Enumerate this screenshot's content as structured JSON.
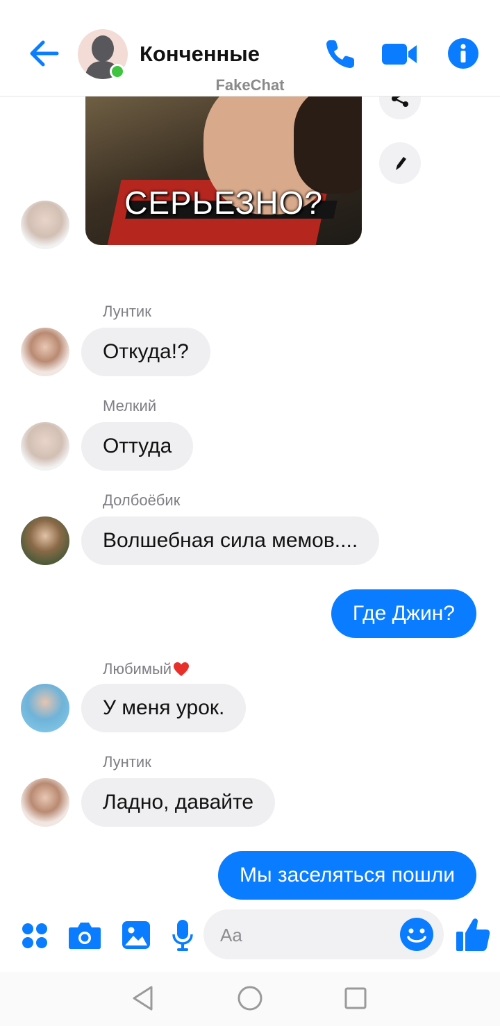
{
  "header": {
    "title": "Конченные",
    "watermark": "FakeChat"
  },
  "meme": {
    "caption": "СЕРЬЕЗНО?"
  },
  "messages": [
    {
      "sender": "Лунтик",
      "text": "Откуда!?"
    },
    {
      "sender": "Мелкий",
      "text": "Оттуда"
    },
    {
      "sender": "Долбоёбик",
      "text": "Волшебная сила мемов...."
    },
    {
      "text": "Где Джин?"
    },
    {
      "sender": "Любимый",
      "text": "У меня урок."
    },
    {
      "sender": "Лунтик",
      "text": "Ладно, давайте"
    },
    {
      "text": "Мы заселяться пошли"
    }
  ],
  "composer": {
    "placeholder": "Aa"
  },
  "colors": {
    "accent": "#0A7CFF",
    "incoming_bubble": "#EFEFF1",
    "online": "#3EC43E"
  },
  "icons": [
    "back-arrow-icon",
    "phone-icon",
    "video-camera-icon",
    "info-icon",
    "share-icon",
    "pencil-icon",
    "apps-grid-icon",
    "camera-icon",
    "gallery-icon",
    "microphone-icon",
    "smile-icon",
    "thumbs-up-icon",
    "nav-back-icon",
    "nav-home-icon",
    "nav-recents-icon"
  ]
}
